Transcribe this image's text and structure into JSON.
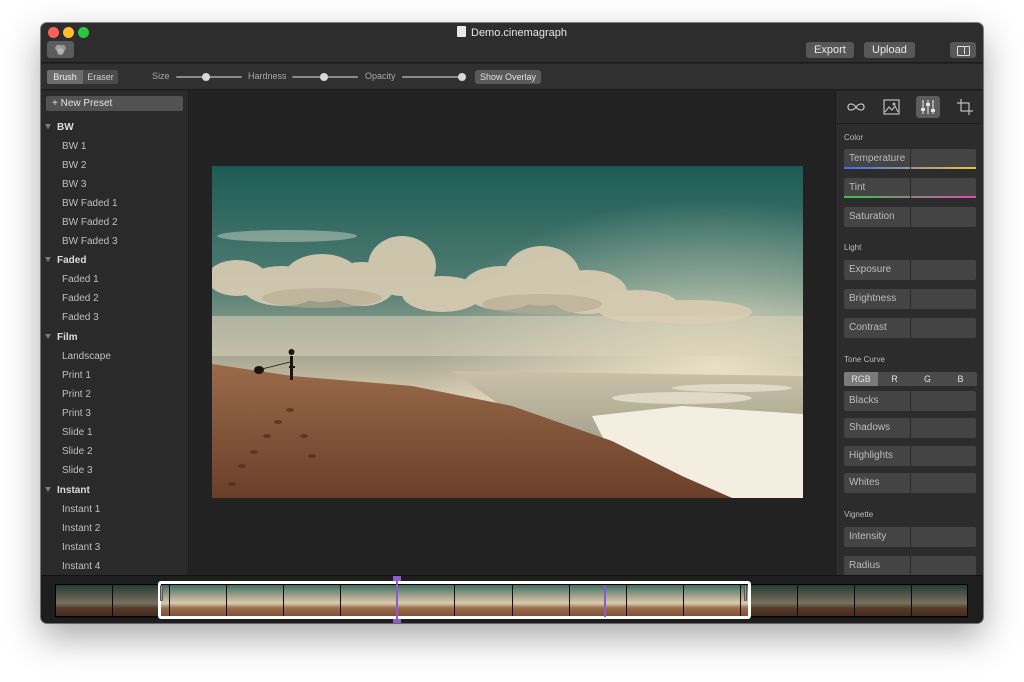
{
  "window": {
    "title": "Demo.cinemagraph",
    "export_label": "Export",
    "upload_label": "Upload"
  },
  "brush_toolbar": {
    "brush_label": "Brush",
    "eraser_label": "Eraser",
    "size_label": "Size",
    "hardness_label": "Hardness",
    "opacity_label": "Opacity",
    "show_overlay_label": "Show Overlay",
    "size_value": 0.45,
    "hardness_value": 0.48,
    "opacity_value": 1.0
  },
  "sidebar": {
    "new_preset_label": "+ New Preset",
    "groups": [
      {
        "name": "BW",
        "items": [
          "BW 1",
          "BW 2",
          "BW 3",
          "BW Faded 1",
          "BW Faded 2",
          "BW Faded 3"
        ]
      },
      {
        "name": "Faded",
        "items": [
          "Faded 1",
          "Faded 2",
          "Faded 3"
        ]
      },
      {
        "name": "Film",
        "items": [
          "Landscape",
          "Print 1",
          "Print 2",
          "Print 3",
          "Slide 1",
          "Slide 2",
          "Slide 3"
        ]
      },
      {
        "name": "Instant",
        "items": [
          "Instant 1",
          "Instant 2",
          "Instant 3",
          "Instant 4"
        ]
      }
    ]
  },
  "right_panel": {
    "tabs": [
      "loop-icon",
      "image-icon",
      "adjustments-icon",
      "crop-icon"
    ],
    "active_tab": "adjustments-icon",
    "color_section": "Color",
    "temperature_label": "Temperature",
    "tint_label": "Tint",
    "saturation_label": "Saturation",
    "light_section": "Light",
    "exposure_label": "Exposure",
    "brightness_label": "Brightness",
    "contrast_label": "Contrast",
    "tone_curve_section": "Tone Curve",
    "curve_channels": [
      "RGB",
      "R",
      "G",
      "B"
    ],
    "blacks_label": "Blacks",
    "shadows_label": "Shadows",
    "highlights_label": "Highlights",
    "whites_label": "Whites",
    "vignette_section": "Vignette",
    "intensity_label": "Intensity",
    "radius_label": "Radius"
  },
  "colors": {
    "accent": "#8e5bcf",
    "temperature_gradient": [
      "#3a6df0",
      "#f0c23a"
    ],
    "tint_gradient": [
      "#3ac24a",
      "#e04ab0"
    ]
  },
  "timeline": {
    "frame_count": 16
  }
}
